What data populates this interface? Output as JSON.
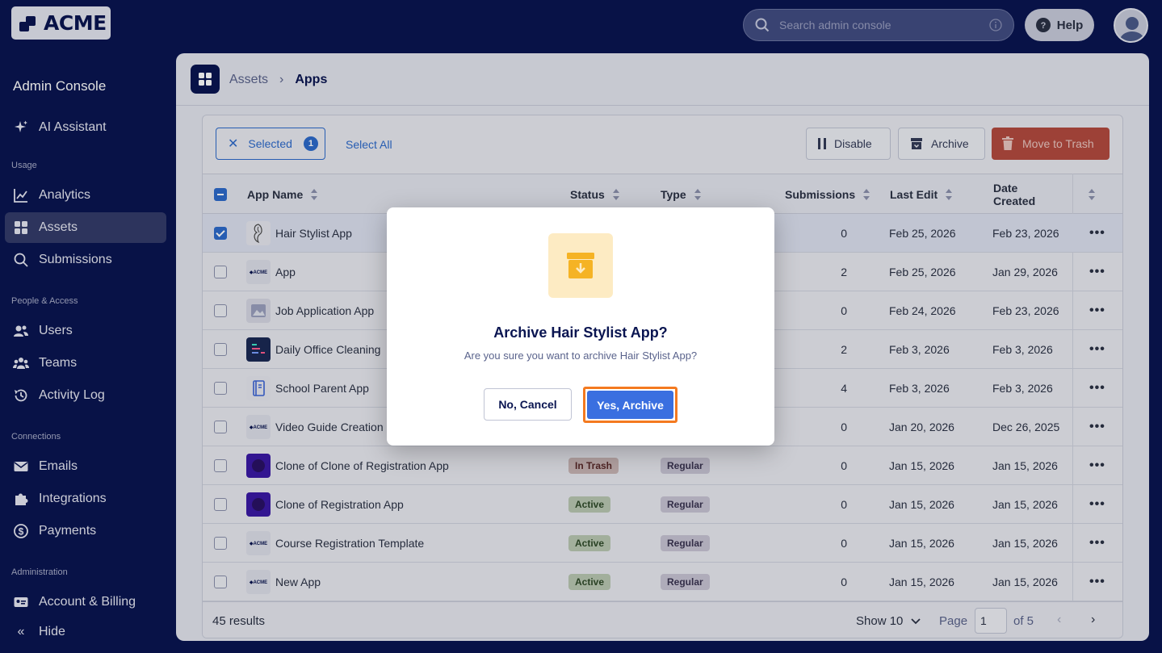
{
  "brand": {
    "logo_text": "ACME"
  },
  "topbar": {
    "search_placeholder": "Search admin console",
    "help_label": "Help"
  },
  "sidebar": {
    "title": "Admin Console",
    "ai_assistant": "AI Assistant",
    "sections": {
      "usage": "Usage",
      "people": "People & Access",
      "connections": "Connections",
      "administration": "Administration"
    },
    "items": {
      "analytics": "Analytics",
      "assets": "Assets",
      "submissions": "Submissions",
      "users": "Users",
      "teams": "Teams",
      "activity_log": "Activity Log",
      "emails": "Emails",
      "integrations": "Integrations",
      "payments": "Payments",
      "account_billing": "Account & Billing"
    },
    "hide_label": "Hide"
  },
  "breadcrumb": {
    "parent": "Assets",
    "current": "Apps"
  },
  "toolbar": {
    "selected_label": "Selected",
    "selected_count": "1",
    "select_all": "Select All",
    "disable": "Disable",
    "archive": "Archive",
    "move_to_trash": "Move to Trash"
  },
  "table": {
    "headers": {
      "name": "App Name",
      "status": "Status",
      "type": "Type",
      "submissions": "Submissions",
      "last_edit": "Last Edit",
      "date_created_1": "Date",
      "date_created_2": "Created"
    },
    "rows": [
      {
        "name": "Hair Stylist App",
        "status": "",
        "type": "",
        "submissions": "0",
        "last_edit": "Feb 25, 2026",
        "created": "Feb 23, 2026",
        "icon": "hair-icon",
        "checked": true
      },
      {
        "name": "App",
        "status": "",
        "type": "",
        "submissions": "2",
        "last_edit": "Feb 25, 2026",
        "created": "Jan 29, 2026",
        "icon": "acme-logo-icon",
        "checked": false
      },
      {
        "name": "Job Application App",
        "status": "",
        "type": "",
        "submissions": "0",
        "last_edit": "Feb 24, 2026",
        "created": "Feb 23, 2026",
        "icon": "image-icon",
        "checked": false
      },
      {
        "name": "Daily Office Cleaning",
        "status": "",
        "type": "",
        "submissions": "2",
        "last_edit": "Feb 3, 2026",
        "created": "Feb 3, 2026",
        "icon": "dashboard-icon",
        "checked": false
      },
      {
        "name": "School Parent App",
        "status": "",
        "type": "",
        "submissions": "4",
        "last_edit": "Feb 3, 2026",
        "created": "Feb 3, 2026",
        "icon": "notebook-icon",
        "checked": false
      },
      {
        "name": "Video Guide Creation",
        "status": "",
        "type": "",
        "submissions": "0",
        "last_edit": "Jan 20, 2026",
        "created": "Dec 26, 2025",
        "icon": "acme-logo-icon",
        "checked": false
      },
      {
        "name": "Clone of Clone of Registration App",
        "status": "In Trash",
        "type": "Regular",
        "submissions": "0",
        "last_edit": "Jan 15, 2026",
        "created": "Jan 15, 2026",
        "icon": "purple-app-icon",
        "checked": false
      },
      {
        "name": "Clone of Registration App",
        "status": "Active",
        "type": "Regular",
        "submissions": "0",
        "last_edit": "Jan 15, 2026",
        "created": "Jan 15, 2026",
        "icon": "purple-app-icon",
        "checked": false
      },
      {
        "name": "Course Registration Template",
        "status": "Active",
        "type": "Regular",
        "submissions": "0",
        "last_edit": "Jan 15, 2026",
        "created": "Jan 15, 2026",
        "icon": "acme-logo-icon",
        "checked": false
      },
      {
        "name": "New App",
        "status": "Active",
        "type": "Regular",
        "submissions": "0",
        "last_edit": "Jan 15, 2026",
        "created": "Jan 15, 2026",
        "icon": "acme-logo-icon",
        "checked": false
      }
    ],
    "row_actions": "•••"
  },
  "footer": {
    "results": "45 results",
    "show": "Show 10",
    "page_label": "Page",
    "page_value": "1",
    "of_label": "of 5",
    "prev": "‹",
    "next": "›"
  },
  "modal": {
    "title": "Archive Hair Stylist App?",
    "text": "Are you sure you want to archive Hair Stylist App?",
    "cancel": "No, Cancel",
    "confirm": "Yes, Archive",
    "icon": "archive-box-icon"
  },
  "colors": {
    "navy": "#0a1551",
    "primary": "#3a6fe0",
    "danger": "#b34a3f",
    "focus": "#f47a20",
    "modal_icon_bg": "#fdebc3",
    "modal_icon_fg": "#f5b325"
  }
}
